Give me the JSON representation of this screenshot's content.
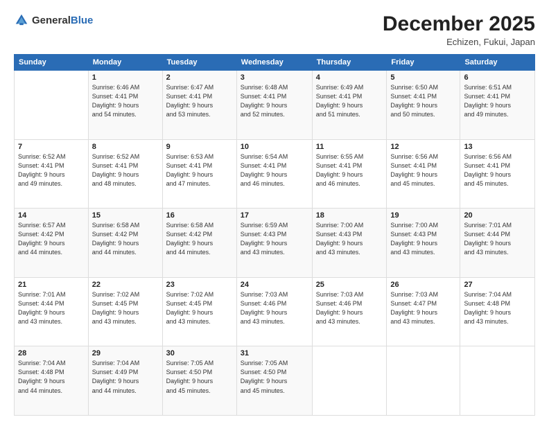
{
  "header": {
    "logo_general": "General",
    "logo_blue": "Blue",
    "title": "December 2025",
    "subtitle": "Echizen, Fukui, Japan"
  },
  "weekdays": [
    "Sunday",
    "Monday",
    "Tuesday",
    "Wednesday",
    "Thursday",
    "Friday",
    "Saturday"
  ],
  "weeks": [
    [
      {
        "day": "",
        "info": ""
      },
      {
        "day": "1",
        "info": "Sunrise: 6:46 AM\nSunset: 4:41 PM\nDaylight: 9 hours\nand 54 minutes."
      },
      {
        "day": "2",
        "info": "Sunrise: 6:47 AM\nSunset: 4:41 PM\nDaylight: 9 hours\nand 53 minutes."
      },
      {
        "day": "3",
        "info": "Sunrise: 6:48 AM\nSunset: 4:41 PM\nDaylight: 9 hours\nand 52 minutes."
      },
      {
        "day": "4",
        "info": "Sunrise: 6:49 AM\nSunset: 4:41 PM\nDaylight: 9 hours\nand 51 minutes."
      },
      {
        "day": "5",
        "info": "Sunrise: 6:50 AM\nSunset: 4:41 PM\nDaylight: 9 hours\nand 50 minutes."
      },
      {
        "day": "6",
        "info": "Sunrise: 6:51 AM\nSunset: 4:41 PM\nDaylight: 9 hours\nand 49 minutes."
      }
    ],
    [
      {
        "day": "7",
        "info": "Sunrise: 6:52 AM\nSunset: 4:41 PM\nDaylight: 9 hours\nand 49 minutes."
      },
      {
        "day": "8",
        "info": "Sunrise: 6:52 AM\nSunset: 4:41 PM\nDaylight: 9 hours\nand 48 minutes."
      },
      {
        "day": "9",
        "info": "Sunrise: 6:53 AM\nSunset: 4:41 PM\nDaylight: 9 hours\nand 47 minutes."
      },
      {
        "day": "10",
        "info": "Sunrise: 6:54 AM\nSunset: 4:41 PM\nDaylight: 9 hours\nand 46 minutes."
      },
      {
        "day": "11",
        "info": "Sunrise: 6:55 AM\nSunset: 4:41 PM\nDaylight: 9 hours\nand 46 minutes."
      },
      {
        "day": "12",
        "info": "Sunrise: 6:56 AM\nSunset: 4:41 PM\nDaylight: 9 hours\nand 45 minutes."
      },
      {
        "day": "13",
        "info": "Sunrise: 6:56 AM\nSunset: 4:41 PM\nDaylight: 9 hours\nand 45 minutes."
      }
    ],
    [
      {
        "day": "14",
        "info": "Sunrise: 6:57 AM\nSunset: 4:42 PM\nDaylight: 9 hours\nand 44 minutes."
      },
      {
        "day": "15",
        "info": "Sunrise: 6:58 AM\nSunset: 4:42 PM\nDaylight: 9 hours\nand 44 minutes."
      },
      {
        "day": "16",
        "info": "Sunrise: 6:58 AM\nSunset: 4:42 PM\nDaylight: 9 hours\nand 44 minutes."
      },
      {
        "day": "17",
        "info": "Sunrise: 6:59 AM\nSunset: 4:43 PM\nDaylight: 9 hours\nand 43 minutes."
      },
      {
        "day": "18",
        "info": "Sunrise: 7:00 AM\nSunset: 4:43 PM\nDaylight: 9 hours\nand 43 minutes."
      },
      {
        "day": "19",
        "info": "Sunrise: 7:00 AM\nSunset: 4:43 PM\nDaylight: 9 hours\nand 43 minutes."
      },
      {
        "day": "20",
        "info": "Sunrise: 7:01 AM\nSunset: 4:44 PM\nDaylight: 9 hours\nand 43 minutes."
      }
    ],
    [
      {
        "day": "21",
        "info": "Sunrise: 7:01 AM\nSunset: 4:44 PM\nDaylight: 9 hours\nand 43 minutes."
      },
      {
        "day": "22",
        "info": "Sunrise: 7:02 AM\nSunset: 4:45 PM\nDaylight: 9 hours\nand 43 minutes."
      },
      {
        "day": "23",
        "info": "Sunrise: 7:02 AM\nSunset: 4:45 PM\nDaylight: 9 hours\nand 43 minutes."
      },
      {
        "day": "24",
        "info": "Sunrise: 7:03 AM\nSunset: 4:46 PM\nDaylight: 9 hours\nand 43 minutes."
      },
      {
        "day": "25",
        "info": "Sunrise: 7:03 AM\nSunset: 4:46 PM\nDaylight: 9 hours\nand 43 minutes."
      },
      {
        "day": "26",
        "info": "Sunrise: 7:03 AM\nSunset: 4:47 PM\nDaylight: 9 hours\nand 43 minutes."
      },
      {
        "day": "27",
        "info": "Sunrise: 7:04 AM\nSunset: 4:48 PM\nDaylight: 9 hours\nand 43 minutes."
      }
    ],
    [
      {
        "day": "28",
        "info": "Sunrise: 7:04 AM\nSunset: 4:48 PM\nDaylight: 9 hours\nand 44 minutes."
      },
      {
        "day": "29",
        "info": "Sunrise: 7:04 AM\nSunset: 4:49 PM\nDaylight: 9 hours\nand 44 minutes."
      },
      {
        "day": "30",
        "info": "Sunrise: 7:05 AM\nSunset: 4:50 PM\nDaylight: 9 hours\nand 45 minutes."
      },
      {
        "day": "31",
        "info": "Sunrise: 7:05 AM\nSunset: 4:50 PM\nDaylight: 9 hours\nand 45 minutes."
      },
      {
        "day": "",
        "info": ""
      },
      {
        "day": "",
        "info": ""
      },
      {
        "day": "",
        "info": ""
      }
    ]
  ]
}
